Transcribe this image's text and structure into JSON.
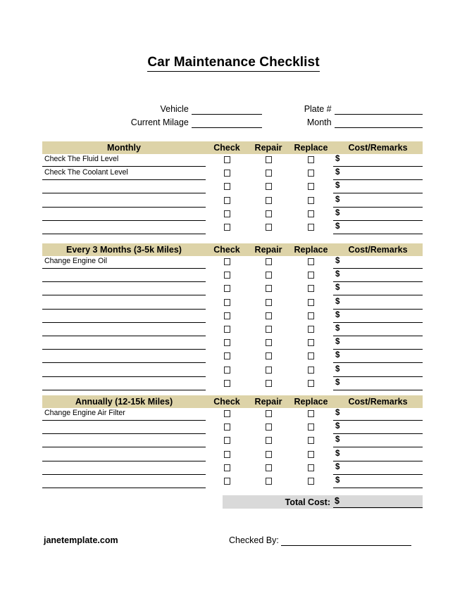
{
  "document": {
    "title": "Car Maintenance Checklist",
    "brand": "janetemplate.com"
  },
  "info": {
    "vehicle_label": "Vehicle",
    "vehicle_value": "",
    "plate_label": "Plate #",
    "plate_value": "",
    "mileage_label": "Current Milage",
    "mileage_value": "",
    "month_label": "Month",
    "month_value": ""
  },
  "columns": {
    "check": "Check",
    "repair": "Repair",
    "replace": "Replace",
    "cost": "Cost/Remarks",
    "currency": "$"
  },
  "sections": [
    {
      "title": "Monthly",
      "rows": [
        {
          "task": "Check The Fluid Level",
          "cost": ""
        },
        {
          "task": "Check The Coolant Level",
          "cost": ""
        },
        {
          "task": "",
          "cost": ""
        },
        {
          "task": "",
          "cost": ""
        },
        {
          "task": "",
          "cost": ""
        },
        {
          "task": "",
          "cost": ""
        }
      ]
    },
    {
      "title": "Every 3 Months (3-5k Miles)",
      "rows": [
        {
          "task": "Change Engine Oil",
          "cost": ""
        },
        {
          "task": "",
          "cost": ""
        },
        {
          "task": "",
          "cost": ""
        },
        {
          "task": "",
          "cost": ""
        },
        {
          "task": "",
          "cost": ""
        },
        {
          "task": "",
          "cost": ""
        },
        {
          "task": "",
          "cost": ""
        },
        {
          "task": "",
          "cost": ""
        },
        {
          "task": "",
          "cost": ""
        },
        {
          "task": "",
          "cost": ""
        }
      ]
    },
    {
      "title": "Annually (12-15k Miles)",
      "rows": [
        {
          "task": "Change Engine Air Filter",
          "cost": ""
        },
        {
          "task": "",
          "cost": ""
        },
        {
          "task": "",
          "cost": ""
        },
        {
          "task": "",
          "cost": ""
        },
        {
          "task": "",
          "cost": ""
        },
        {
          "task": "",
          "cost": ""
        }
      ]
    }
  ],
  "total": {
    "label": "Total Cost:",
    "currency": "$",
    "value": ""
  },
  "footer": {
    "checked_by_label": "Checked By:",
    "checked_by_value": ""
  },
  "theme": {
    "header_band": "#ddd3a8",
    "total_band": "#d9d9d9",
    "text": "#000000"
  },
  "layout": {
    "section_tops": [
      201,
      346,
      562
    ]
  }
}
